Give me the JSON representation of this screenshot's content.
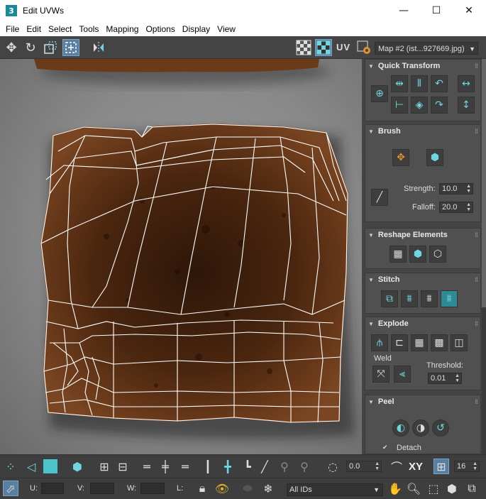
{
  "window": {
    "title": "Edit UVWs",
    "app_icon_text": "3",
    "minimize": "—",
    "maximize": "☐",
    "close": "✕"
  },
  "menu": {
    "items": [
      "File",
      "Edit",
      "Select",
      "Tools",
      "Mapping",
      "Options",
      "Display",
      "View"
    ]
  },
  "toolbar": {
    "uv_label": "UV",
    "map_select": "Map #2 (ist...927669.jpg)",
    "icons": [
      "move-icon",
      "rotate-icon",
      "scale-icon",
      "freeform-icon",
      "mirror-icon",
      "checker-pattern-icon",
      "checker-active-icon",
      "uv-options-icon"
    ]
  },
  "panel": {
    "quick_transform": {
      "title": "Quick Transform"
    },
    "brush": {
      "title": "Brush",
      "strength_label": "Strength:",
      "strength_value": "10.0",
      "falloff_label": "Falloff:",
      "falloff_value": "20.0"
    },
    "reshape": {
      "title": "Reshape Elements"
    },
    "stitch": {
      "title": "Stitch"
    },
    "explode": {
      "title": "Explode",
      "weld_label": "Weld",
      "threshold_label": "Threshold:",
      "threshold_value": "0.01"
    },
    "peel": {
      "title": "Peel",
      "detach_label": "Detach",
      "detach_checked": true
    }
  },
  "bottom1": {
    "angle_value": "0.0",
    "xy_label": "XY",
    "grid_value": "16"
  },
  "bottom2": {
    "u_label": "U:",
    "v_label": "V:",
    "w_label": "W:",
    "l_label": "L:",
    "ids_select": "All IDs"
  },
  "colors": {
    "accent": "#6fd6e0",
    "panel_bg": "#444444",
    "toast_crust": "#5a2f14",
    "toast_crumb": "#3d2010"
  }
}
